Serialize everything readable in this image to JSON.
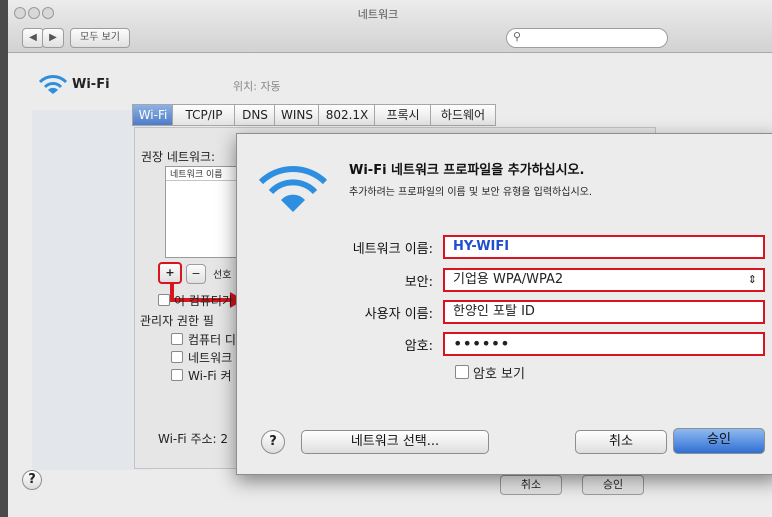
{
  "window": {
    "title": "네트워크",
    "show_all": "모두 보기"
  },
  "pane": {
    "wifi_label": "Wi-Fi",
    "bg_location": "위치: 자동"
  },
  "tabs": [
    "Wi-Fi",
    "TCP/IP",
    "DNS",
    "WINS",
    "802.1X",
    "프록시",
    "하드웨어"
  ],
  "settings": {
    "preferred_networks": "권장 네트워크:",
    "network_name_col": "네트워크 이름",
    "add": "+",
    "remove": "−",
    "show_label": "선호",
    "remember_label": "이 컴퓨터가",
    "admin_label": "관리자 권한 필",
    "opt1": "컴퓨터 디",
    "opt2": "네트워크",
    "opt3": "Wi-Fi 켜",
    "wifi_address": "Wi-Fi 주소: 2",
    "cancel": "취소",
    "ok": "승인",
    "help": "?"
  },
  "dialog": {
    "title": "Wi-Fi 네트워크 프로파일을 추가하십시오.",
    "subtitle": "추가하려는 프로파일의 이름 및 보안 유형을 입력하십시오.",
    "network_name_label": "네트워크 이름:",
    "network_name_value": "HY-WIFI",
    "security_label": "보안:",
    "security_value": "기업용 WPA/WPA2",
    "username_label": "사용자 이름:",
    "username_value": "한양인 포탈 ID",
    "password_label": "암호:",
    "password_value": "••••••",
    "show_password": "암호 보기",
    "choose_network": "네트워크 선택...",
    "cancel": "취소",
    "ok": "승인",
    "help": "?"
  },
  "colors": {
    "highlight": "#d8141e",
    "wifi_blue": "#2e8fe0",
    "tab_selected": "#4c7cc9"
  }
}
